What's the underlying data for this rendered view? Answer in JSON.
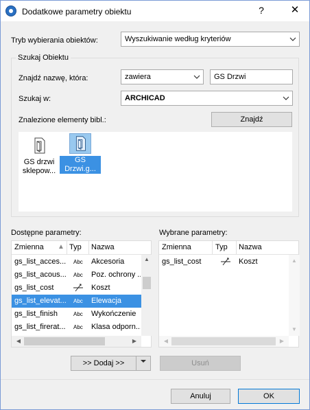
{
  "window": {
    "title": "Dodatkowe parametry obiektu",
    "help": "?",
    "close": "✕"
  },
  "mode": {
    "label": "Tryb wybierania obiektów:",
    "value": "Wyszukiwanie według kryteriów"
  },
  "search_group": {
    "title": "Szukaj Obiektu",
    "find_name_label": "Znajdź nazwę, która:",
    "condition_value": "zawiera",
    "search_text": "GS Drzwi",
    "search_in_label": "Szukaj w:",
    "search_in_value": "ARCHICAD",
    "found_label": "Znalezione elementy bibl.:",
    "find_button": "Znajdź",
    "items": [
      {
        "line1": "GS drzwi",
        "line2": "sklepow...",
        "selected": false
      },
      {
        "line1": "GS",
        "line2": "Drzwi.g...",
        "selected": true
      }
    ]
  },
  "available": {
    "label": "Dostępne parametry:",
    "columns": {
      "variable": "Zmienna",
      "type": "Typ",
      "name": "Nazwa"
    },
    "rows": [
      {
        "variable": "gs_list_acces...",
        "type": "Abc",
        "type_icon": "text-type-icon",
        "name": "Akcesoria",
        "selected": false
      },
      {
        "variable": "gs_list_acous...",
        "type": "Abc",
        "type_icon": "text-type-icon",
        "name": "Poz. ochrony ...",
        "selected": false
      },
      {
        "variable": "gs_list_cost",
        "type": "",
        "type_icon": "real-number-icon",
        "name": "Koszt",
        "selected": false
      },
      {
        "variable": "gs_list_elevat...",
        "type": "Abc",
        "type_icon": "text-type-icon",
        "name": "Elewacja",
        "selected": true
      },
      {
        "variable": "gs_list_finish",
        "type": "Abc",
        "type_icon": "text-type-icon",
        "name": "Wykończenie",
        "selected": false
      },
      {
        "variable": "gs_list_firerat...",
        "type": "Abc",
        "type_icon": "text-type-icon",
        "name": "Klasa odporn...",
        "selected": false
      }
    ]
  },
  "selected_params": {
    "label": "Wybrane parametry:",
    "columns": {
      "variable": "Zmienna",
      "type": "Typ",
      "name": "Nazwa"
    },
    "rows": [
      {
        "variable": "gs_list_cost",
        "type_icon": "real-number-icon",
        "name": "Koszt"
      }
    ]
  },
  "actions": {
    "add": ">> Dodaj >>",
    "remove": "Usuń"
  },
  "footer": {
    "cancel": "Anuluj",
    "ok": "OK"
  },
  "colors": {
    "selection": "#3b91e3",
    "dialog_bg": "#f0f0f0",
    "border": "#7a9ad6"
  }
}
